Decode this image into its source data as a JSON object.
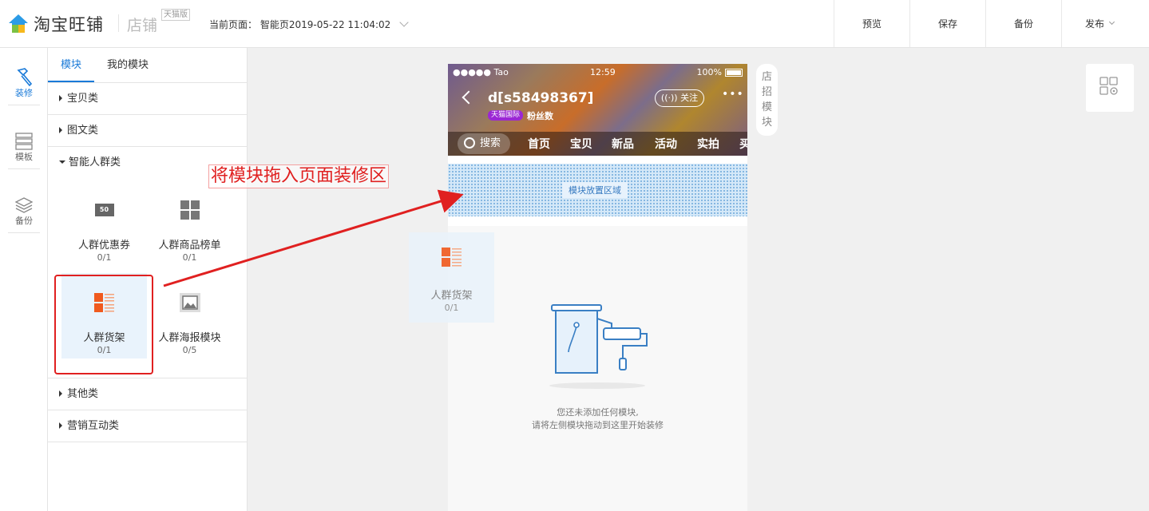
{
  "header": {
    "brand": "淘宝旺铺",
    "shop_label": "店铺",
    "tmall_badge": "天猫版",
    "current_page_label": "当前页面：",
    "current_page_value": "智能页2019-05-22 11:04:02",
    "actions": [
      {
        "label": "预览"
      },
      {
        "label": "保存"
      },
      {
        "label": "备份"
      },
      {
        "label": "发布"
      }
    ]
  },
  "rail": [
    {
      "label": "装修",
      "icon": "hammer-icon",
      "active": true
    },
    {
      "label": "模板",
      "icon": "template-icon",
      "active": false
    },
    {
      "label": "备份",
      "icon": "layers-icon",
      "active": false
    }
  ],
  "panel": {
    "tabs": [
      {
        "label": "模块"
      },
      {
        "label": "我的模块"
      }
    ],
    "categories": [
      {
        "label": "宝贝类"
      },
      {
        "label": "图文类"
      },
      {
        "label": "智能人群类"
      },
      {
        "label": "其他类"
      },
      {
        "label": "营销互动类"
      }
    ],
    "modules": [
      {
        "name": "人群优惠券",
        "count": "0/1",
        "icon": "coupon-icon",
        "icon_text": "50"
      },
      {
        "name": "人群商品榜单",
        "count": "0/1",
        "icon": "grid-icon"
      },
      {
        "name": "人群货架",
        "count": "0/1",
        "icon": "shelf-icon"
      },
      {
        "name": "人群海报模块",
        "count": "0/5",
        "icon": "image-icon"
      }
    ]
  },
  "annotation": {
    "text": "将模块拖入页面装修区",
    "color": "#e02020"
  },
  "phone": {
    "status_left": "●●●●● Tao",
    "status_time": "12:59",
    "status_battery": "100%",
    "shop_title": "d[s58498367]",
    "follow": "关注",
    "tmall_intl": "天猫国际",
    "fans": "粉丝数",
    "search": "搜索",
    "nav": [
      "首页",
      "宝贝",
      "新品",
      "活动",
      "实拍",
      "买"
    ],
    "drop_label": "模块放置区域",
    "empty_line1": "您还未添加任何模块,",
    "empty_line2": "请将左侧模块拖动到这里开始装修"
  },
  "side_tag": "店招模块",
  "side_tag_chars": [
    "店",
    "招",
    "模",
    "块"
  ],
  "ghost": {
    "name": "人群货架",
    "count": "0/1"
  },
  "colors": {
    "accent": "#1a7ad8",
    "shelf_orange": "#f05a1e",
    "annotation_red": "#e02020"
  }
}
